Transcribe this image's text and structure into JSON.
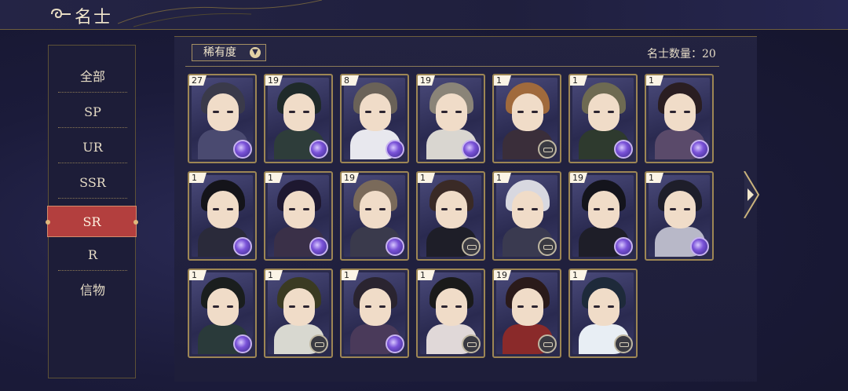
{
  "header": {
    "back_icon": "cloud-back-icon",
    "title": "名士"
  },
  "sidebar": {
    "items": [
      {
        "label": "全部",
        "active": false
      },
      {
        "label": "SP",
        "active": false
      },
      {
        "label": "UR",
        "active": false
      },
      {
        "label": "SSR",
        "active": false
      },
      {
        "label": "SR",
        "active": true
      },
      {
        "label": "R",
        "active": false
      },
      {
        "label": "信物",
        "active": false
      }
    ]
  },
  "filter": {
    "label": "稀有度",
    "icon": "chevron-down-icon"
  },
  "count_text": "名士数量：20",
  "cards": [
    {
      "level": "27",
      "hair": "#3a3a4a",
      "body": "#4a4a70",
      "badge": "orb"
    },
    {
      "level": "19",
      "hair": "#1f2a2a",
      "body": "#2e3d3a",
      "badge": "orb"
    },
    {
      "level": "8",
      "hair": "#6a6258",
      "body": "#e8e8ee",
      "badge": "orb"
    },
    {
      "level": "19",
      "hair": "#8a8478",
      "body": "#d9d6d0",
      "badge": "orb"
    },
    {
      "level": "1",
      "hair": "#a06a3c",
      "body": "#3a2e3a",
      "badge": "seal"
    },
    {
      "level": "1",
      "hair": "#6e6a52",
      "body": "#2e3a2e",
      "badge": "orb"
    },
    {
      "level": "1",
      "hair": "#2a1e22",
      "body": "#5a4a6a",
      "badge": "orb"
    },
    {
      "level": "1",
      "hair": "#14141a",
      "body": "#2a2a3a",
      "badge": "orb"
    },
    {
      "level": "1",
      "hair": "#1e1830",
      "body": "#3a3048",
      "badge": "orb"
    },
    {
      "level": "19",
      "hair": "#7a6a5a",
      "body": "#3a3a4c",
      "badge": "orb"
    },
    {
      "level": "1",
      "hair": "#3a2a26",
      "body": "#1e1e28",
      "badge": "seal"
    },
    {
      "level": "1",
      "hair": "#d8d8e0",
      "body": "#3a3a50",
      "badge": "seal"
    },
    {
      "level": "19",
      "hair": "#14141c",
      "body": "#1e1e28",
      "badge": "orb"
    },
    {
      "level": "1",
      "hair": "#1e1e2a",
      "body": "#b8b8c8",
      "badge": "orb"
    },
    {
      "level": "1",
      "hair": "#1a1e1e",
      "body": "#2a3a3a",
      "badge": "orb"
    },
    {
      "level": "1",
      "hair": "#3a3a22",
      "body": "#d8d8d0",
      "badge": "seal"
    },
    {
      "level": "1",
      "hair": "#2a2430",
      "body": "#4a3a5a",
      "badge": "orb"
    },
    {
      "level": "1",
      "hair": "#1a1a1a",
      "body": "#e0d8d8",
      "badge": "seal"
    },
    {
      "level": "19",
      "hair": "#2a1a1a",
      "body": "#8a2a2a",
      "badge": "seal"
    },
    {
      "level": "1",
      "hair": "#1e2a3a",
      "body": "#e8eef4",
      "badge": "seal"
    }
  ],
  "side_arrow_icon": "chevron-right-icon"
}
